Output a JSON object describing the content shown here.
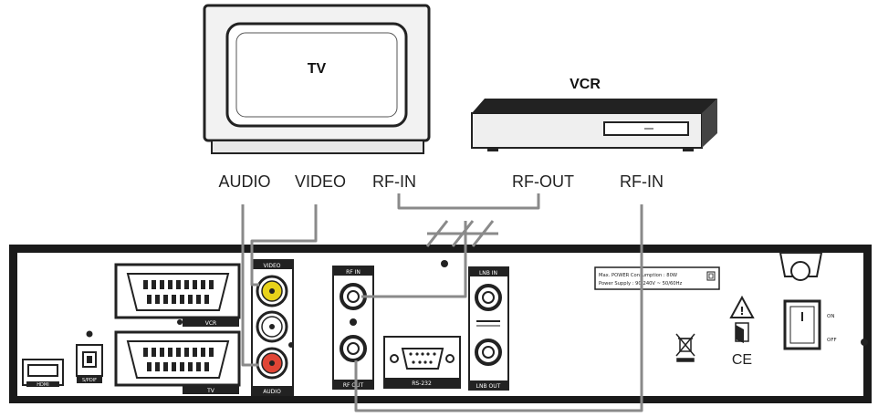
{
  "devices": {
    "tv_label": "TV",
    "vcr_label": "VCR"
  },
  "tv_ports": {
    "audio": "AUDIO",
    "video": "VIDEO",
    "rf_in": "RF-IN"
  },
  "vcr_ports": {
    "rf_out": "RF-OUT",
    "rf_in": "RF-IN"
  },
  "receiver_panel": {
    "vcr_scart": "VCR",
    "tv_scart": "TV",
    "video_rca": "VIDEO",
    "audio_rca": "AUDIO",
    "rf_in": "RF IN",
    "rf_out": "RF OUT",
    "rs232": "RS-232",
    "lnb_in": "LNB IN",
    "lnb_out": "LNB OUT",
    "hdmi": "HDMI",
    "spdif": "S/PDIF",
    "power_info": "Max. POWER Consumption : 80W",
    "power_supply": "Power Supply : 90-240V ~ 50/60Hz",
    "switch_on": "ON",
    "switch_off": "OFF",
    "ce_mark": "CE"
  },
  "colors": {
    "cable": "#8a8a8a",
    "panel": "#111111",
    "video_rca": "#e8d21a",
    "audio_rca": "#e04535"
  }
}
